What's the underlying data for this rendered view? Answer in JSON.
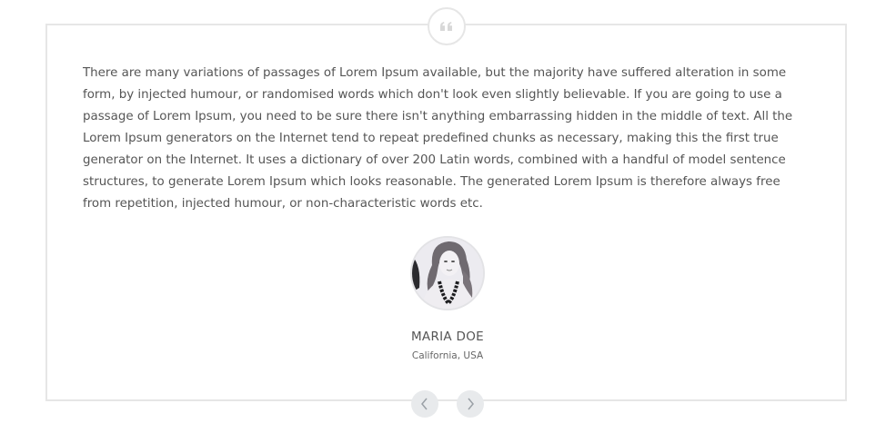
{
  "testimonial": {
    "quote_icon": "quote-icon",
    "text": "There are many variations of passages of Lorem Ipsum available, but the majority have suffered alteration in some form, by injected humour, or randomised words which don't look even slightly believable. If you are going to use a passage of Lorem Ipsum, you need to be sure there isn't anything embarrassing hidden in the middle of text. All the Lorem Ipsum generators on the Internet tend to repeat predefined chunks as necessary, making this the first true generator on the Internet. It uses a dictionary of over 200 Latin words, combined with a handful of model sentence structures, to generate Lorem Ipsum which looks reasonable. The generated Lorem Ipsum is therefore always free from repetition, injected humour, or non-characteristic words etc.",
    "author": {
      "name": "MARIA DOE",
      "location": "California, USA",
      "avatar_icon": "avatar-photo"
    }
  },
  "navigation": {
    "prev_icon": "chevron-left-icon",
    "next_icon": "chevron-right-icon"
  },
  "colors": {
    "border": "#e6e6e6",
    "text": "#555555",
    "nav_bg": "#e8eaec",
    "nav_icon": "#9aa0a6"
  }
}
